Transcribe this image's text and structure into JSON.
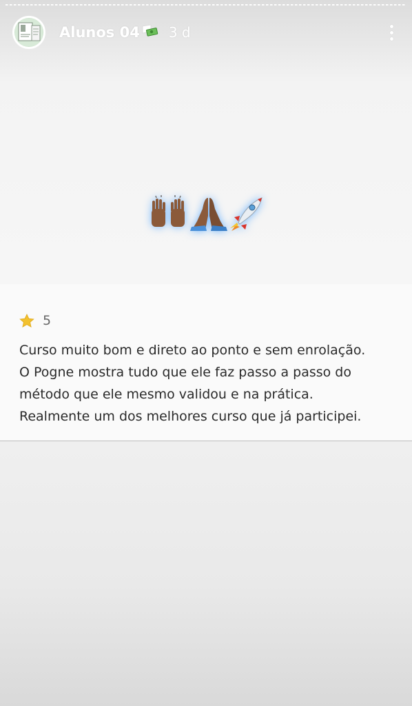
{
  "header": {
    "username": "Alunos 04",
    "username_emoji": "money-with-wings",
    "time": "3 d",
    "menu_icon": "more-vertical-icon",
    "avatar": "profile-avatar"
  },
  "sticker": {
    "emojis": [
      "raising-hands-emoji",
      "folded-hands-emoji",
      "rocket-emoji"
    ],
    "glow_color": "#5aaaff"
  },
  "review": {
    "star_icon": "star-icon",
    "star_color": "#f2c12e",
    "rating": "5",
    "lines": [
      "Curso muito bom e direto ao ponto e sem enrolação.",
      "O Pogne mostra tudo que ele faz passo a passo do",
      "método que ele mesmo validou e na prática.",
      "Realmente um dos melhores curso que já participei."
    ]
  }
}
